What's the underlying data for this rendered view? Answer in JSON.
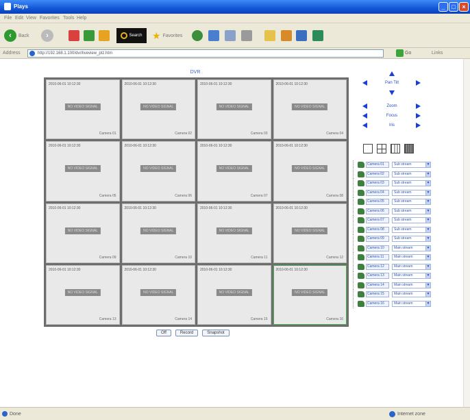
{
  "window": {
    "title": "Plays"
  },
  "menu": [
    "File",
    "Edit",
    "View",
    "Favorites",
    "Tools",
    "Help"
  ],
  "toolbar": {
    "back_label": "Back",
    "search_label": "Search",
    "favorites_label": "Favorites"
  },
  "address": {
    "label": "Address",
    "url": "http://192.168.1.100/dvr/liveview_ptz.htm",
    "go_label": "Go",
    "links_label": "Links"
  },
  "page": {
    "title": "DVR"
  },
  "grid_cells": [
    {
      "ts": "2010-06-01 10:12:30",
      "label": "NO VIDEO SIGNAL",
      "ch": "Camera 01"
    },
    {
      "ts": "2010-06-01 10:12:30",
      "label": "NO VIDEO SIGNAL",
      "ch": "Camera 02"
    },
    {
      "ts": "2010-06-01 10:12:30",
      "label": "NO VIDEO SIGNAL",
      "ch": "Camera 03"
    },
    {
      "ts": "2010-06-01 10:12:30",
      "label": "NO VIDEO SIGNAL",
      "ch": "Camera 04"
    },
    {
      "ts": "2010-06-01 10:12:30",
      "label": "NO VIDEO SIGNAL",
      "ch": "Camera 05"
    },
    {
      "ts": "2010-06-01 10:12:30",
      "label": "NO VIDEO SIGNAL",
      "ch": "Camera 06"
    },
    {
      "ts": "2010-06-01 10:12:30",
      "label": "NO VIDEO SIGNAL",
      "ch": "Camera 07"
    },
    {
      "ts": "2010-06-01 10:12:30",
      "label": "NO VIDEO SIGNAL",
      "ch": "Camera 08"
    },
    {
      "ts": "2010-06-01 10:12:30",
      "label": "NO VIDEO SIGNAL",
      "ch": "Camera 09"
    },
    {
      "ts": "2010-06-01 10:12:30",
      "label": "NO VIDEO SIGNAL",
      "ch": "Camera 10"
    },
    {
      "ts": "2010-06-01 10:12:30",
      "label": "NO VIDEO SIGNAL",
      "ch": "Camera 11"
    },
    {
      "ts": "2010-06-01 10:12:30",
      "label": "NO VIDEO SIGNAL",
      "ch": "Camera 12"
    },
    {
      "ts": "2010-06-01 10:12:30",
      "label": "NO VIDEO SIGNAL",
      "ch": "Camera 13"
    },
    {
      "ts": "2010-06-01 10:12:30",
      "label": "NO VIDEO SIGNAL",
      "ch": "Camera 14"
    },
    {
      "ts": "2010-06-01 10:12:30",
      "label": "NO VIDEO SIGNAL",
      "ch": "Camera 15"
    },
    {
      "ts": "2010-06-01 10:12:30",
      "label": "NO VIDEO SIGNAL",
      "ch": "Camera 16"
    }
  ],
  "buttons": [
    "Off",
    "Record",
    "Snapshot"
  ],
  "ptz": {
    "pan_tilt": "Pan Tilt",
    "zoom": "Zoom",
    "focus": "Focus",
    "iris": "Iris"
  },
  "cameras": [
    {
      "name": "Camera 01",
      "stream": "Sub stream"
    },
    {
      "name": "Camera 02",
      "stream": "Sub stream"
    },
    {
      "name": "Camera 03",
      "stream": "Sub stream"
    },
    {
      "name": "Camera 04",
      "stream": "Sub stream"
    },
    {
      "name": "Camera 05",
      "stream": "Sub stream"
    },
    {
      "name": "Camera 06",
      "stream": "Sub stream"
    },
    {
      "name": "Camera 07",
      "stream": "Sub stream"
    },
    {
      "name": "Camera 08",
      "stream": "Sub stream"
    },
    {
      "name": "Camera 09",
      "stream": "Sub stream"
    },
    {
      "name": "Camera 10",
      "stream": "Main stream"
    },
    {
      "name": "Camera 11",
      "stream": "Main stream"
    },
    {
      "name": "Camera 12",
      "stream": "Main stream"
    },
    {
      "name": "Camera 13",
      "stream": "Main stream"
    },
    {
      "name": "Camera 14",
      "stream": "Main stream"
    },
    {
      "name": "Camera 15",
      "stream": "Main stream"
    },
    {
      "name": "Camera 16",
      "stream": "Main stream"
    }
  ],
  "status": {
    "left": "Done",
    "right": "Internet zone"
  }
}
